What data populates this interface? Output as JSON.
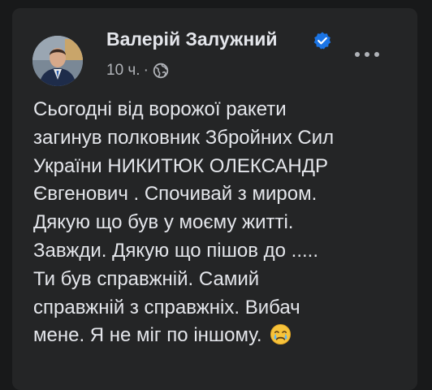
{
  "post": {
    "author": {
      "name": "Валерій Залужний",
      "verified": true,
      "avatar_icon": "profile-photo-icon"
    },
    "meta": {
      "time": "10 ч.",
      "separator": "·",
      "audience_icon": "globe-icon"
    },
    "more_icon": "more-options-icon",
    "text_lines": [
      "Сьогодні від ворожої ракети",
      "загинув полковник Збройних Сил",
      "України НИКИТЮК ОЛЕКСАНДР",
      "Євгенович . Спочивай з миром.",
      "Дякую що був у моєму житті.",
      "Завжди. Дякую що пішов до .....",
      "Ти був справжній. Самий",
      "справжній з справжніх. Вибач",
      "мене. Я не міг по іншому."
    ],
    "trailing_emoji": "crying-face-emoji"
  },
  "colors": {
    "background": "#18191a",
    "card": "#242526",
    "text_primary": "#e4e6eb",
    "text_secondary": "#b0b3b8",
    "verified_blue": "#1b74e4"
  }
}
